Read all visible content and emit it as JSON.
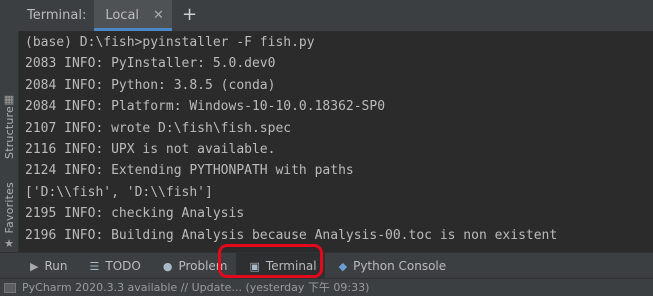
{
  "side_tabs": {
    "structure_label": "Structure",
    "favorites_label": "Favorites"
  },
  "terminal_header": {
    "title": "Terminal:",
    "tab_label": "Local",
    "close_symbol": "✕",
    "add_symbol": "+"
  },
  "terminal_lines": [
    "(base) D:\\fish>pyinstaller -F fish.py",
    "2083 INFO: PyInstaller: 5.0.dev0",
    "2084 INFO: Python: 3.8.5 (conda)",
    "2084 INFO: Platform: Windows-10-10.0.18362-SP0",
    "2107 INFO: wrote D:\\fish\\fish.spec",
    "2116 INFO: UPX is not available.",
    "2124 INFO: Extending PYTHONPATH with paths",
    "['D:\\\\fish', 'D:\\\\fish']",
    "2195 INFO: checking Analysis",
    "2196 INFO: Building Analysis because Analysis-00.toc is non existent"
  ],
  "tool_windows": {
    "run": "Run",
    "todo": "TODO",
    "problems": "Problem",
    "terminal": "Terminal",
    "python_console": "Python Console"
  },
  "icons": {
    "run": "play-icon",
    "todo": "list-icon",
    "problems": "info-icon",
    "terminal": "terminal-icon",
    "python_console": "python-icon",
    "structure": "structure-icon",
    "favorites": "star-icon"
  },
  "status_bar": {
    "message": "PyCharm 2020.3.3 available // Update... (yesterday 下午 09:33)"
  },
  "colors": {
    "highlight": "#e3081c",
    "active_tab_underline": "#4a88c7"
  }
}
